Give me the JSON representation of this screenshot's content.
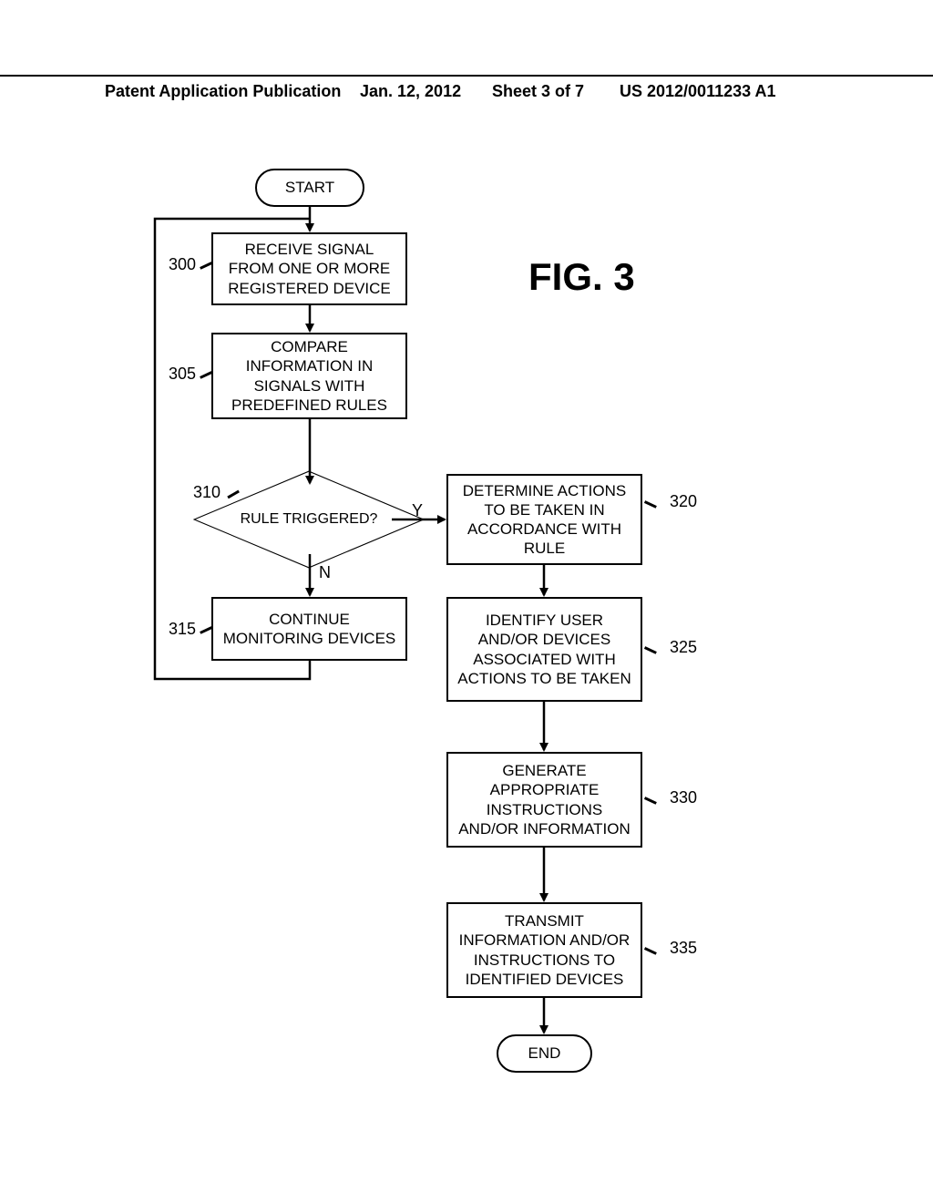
{
  "header": {
    "left": "Patent Application Publication",
    "date": "Jan. 12, 2012",
    "sheet": "Sheet 3 of 7",
    "pubno": "US 2012/0011233 A1"
  },
  "figure_label": "FIG. 3",
  "nodes": {
    "start": "START",
    "n300": "RECEIVE SIGNAL FROM ONE OR MORE REGISTERED DEVICE",
    "n305": "COMPARE INFORMATION IN SIGNALS WITH PREDEFINED RULES",
    "n310": "RULE TRIGGERED?",
    "n315": "CONTINUE MONITORING DEVICES",
    "n320": "DETERMINE ACTIONS TO BE TAKEN IN ACCORDANCE WITH RULE",
    "n325": "IDENTIFY USER AND/OR DEVICES ASSOCIATED WITH ACTIONS TO BE TAKEN",
    "n330": "GENERATE APPROPRIATE INSTRUCTIONS AND/OR INFORMATION",
    "n335": "TRANSMIT INFORMATION AND/OR INSTRUCTIONS TO IDENTIFIED DEVICES",
    "end": "END"
  },
  "refs": {
    "r300": "300",
    "r305": "305",
    "r310": "310",
    "r315": "315",
    "r320": "320",
    "r325": "325",
    "r330": "330",
    "r335": "335"
  },
  "branches": {
    "yes": "Y",
    "no": "N"
  },
  "chart_data": {
    "type": "flowchart",
    "title": "FIG. 3",
    "nodes": [
      {
        "id": "start",
        "kind": "terminator",
        "label": "START"
      },
      {
        "id": "300",
        "kind": "process",
        "label": "RECEIVE SIGNAL FROM ONE OR MORE REGISTERED DEVICE"
      },
      {
        "id": "305",
        "kind": "process",
        "label": "COMPARE INFORMATION IN SIGNALS WITH PREDEFINED RULES"
      },
      {
        "id": "310",
        "kind": "decision",
        "label": "RULE TRIGGERED?"
      },
      {
        "id": "315",
        "kind": "process",
        "label": "CONTINUE MONITORING DEVICES"
      },
      {
        "id": "320",
        "kind": "process",
        "label": "DETERMINE ACTIONS TO BE TAKEN IN ACCORDANCE WITH RULE"
      },
      {
        "id": "325",
        "kind": "process",
        "label": "IDENTIFY USER AND/OR DEVICES ASSOCIATED WITH ACTIONS TO BE TAKEN"
      },
      {
        "id": "330",
        "kind": "process",
        "label": "GENERATE APPROPRIATE INSTRUCTIONS AND/OR INFORMATION"
      },
      {
        "id": "335",
        "kind": "process",
        "label": "TRANSMIT INFORMATION AND/OR INSTRUCTIONS TO IDENTIFIED DEVICES"
      },
      {
        "id": "end",
        "kind": "terminator",
        "label": "END"
      }
    ],
    "edges": [
      {
        "from": "start",
        "to": "300"
      },
      {
        "from": "300",
        "to": "305"
      },
      {
        "from": "305",
        "to": "310"
      },
      {
        "from": "310",
        "to": "320",
        "label": "Y"
      },
      {
        "from": "310",
        "to": "315",
        "label": "N"
      },
      {
        "from": "315",
        "to": "300",
        "note": "loop back"
      },
      {
        "from": "320",
        "to": "325"
      },
      {
        "from": "325",
        "to": "330"
      },
      {
        "from": "330",
        "to": "335"
      },
      {
        "from": "335",
        "to": "end"
      }
    ]
  }
}
